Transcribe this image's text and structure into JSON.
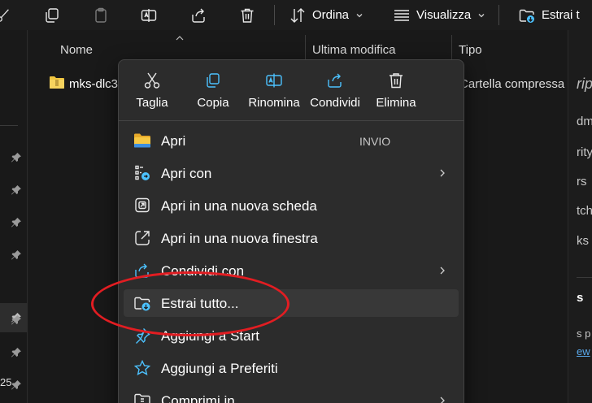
{
  "toolbar": {
    "sort_label": "Ordina",
    "view_label": "Visualizza",
    "extract_label": "Estrai t"
  },
  "columns": {
    "name": "Nome",
    "modified": "Ultima modifica",
    "type": "Tipo"
  },
  "files": [
    {
      "name": "mks-dlc3",
      "type": "Cartella compressa"
    }
  ],
  "left_nav": {
    "partial_number": "25"
  },
  "right_pane": {
    "fragments": [
      "ript",
      "dm",
      "rity",
      "rs",
      "tch",
      "ks",
      "s",
      "s p",
      "ew"
    ]
  },
  "context_menu": {
    "quick_actions": [
      {
        "label": "Taglia",
        "icon": "scissors-icon"
      },
      {
        "label": "Copia",
        "icon": "copy-icon"
      },
      {
        "label": "Rinomina",
        "icon": "rename-icon"
      },
      {
        "label": "Condividi",
        "icon": "share-icon"
      },
      {
        "label": "Elimina",
        "icon": "trash-icon"
      }
    ],
    "items": [
      {
        "label": "Apri",
        "accelerator": "INVIO",
        "icon": "folder-icon"
      },
      {
        "label": "Apri con",
        "icon": "open-with-icon",
        "submenu": true
      },
      {
        "label": "Apri in una nuova scheda",
        "icon": "new-tab-icon"
      },
      {
        "label": "Apri in una nuova finestra",
        "icon": "new-window-icon"
      },
      {
        "label": "Condividi con",
        "icon": "share-with-icon",
        "submenu": true
      },
      {
        "label": "Estrai tutto...",
        "icon": "extract-folder-icon",
        "highlighted": true
      },
      {
        "label": "Aggiungi a Start",
        "icon": "pin-icon"
      },
      {
        "label": "Aggiungi a Preferiti",
        "icon": "star-icon"
      },
      {
        "label": "Comprimi in",
        "icon": "compress-icon",
        "submenu": true
      }
    ]
  },
  "colors": {
    "background": "#191919",
    "menu_background": "#2c2c2c",
    "accent": "#4cc2ff",
    "annotation": "#e21d22",
    "folder": "#f0c540"
  }
}
